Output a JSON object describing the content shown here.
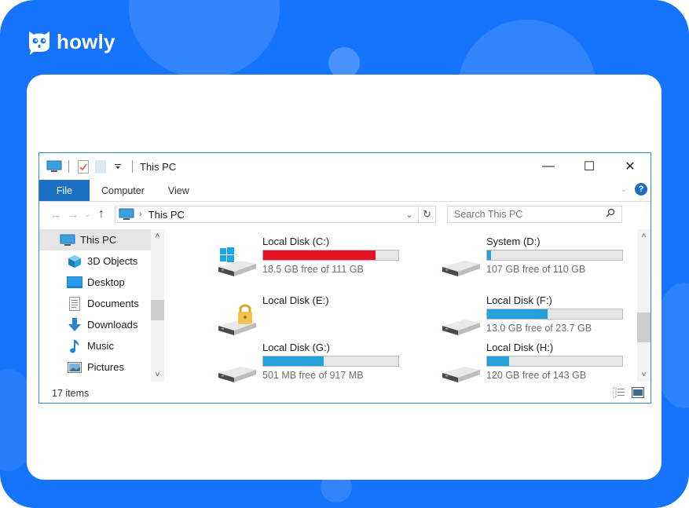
{
  "brand": {
    "name": "howly",
    "color": "#1574fb"
  },
  "window": {
    "title": "This PC",
    "quick_access_icons": [
      "computer-icon",
      "properties-icon",
      "new-folder-icon",
      "customize-dropdown-icon"
    ],
    "controls": {
      "minimize": "—",
      "maximize": "☐",
      "close": "✕"
    }
  },
  "ribbon": {
    "tabs": [
      {
        "label": "File",
        "active": true
      },
      {
        "label": "Computer",
        "active": false
      },
      {
        "label": "View",
        "active": false
      }
    ],
    "expand_icon": "⌄",
    "help_icon": "?"
  },
  "navigation": {
    "back": "←",
    "forward": "→",
    "recent": "⌄",
    "up": "↑",
    "address": {
      "separator": "›",
      "path": "This PC"
    },
    "address_dropdown": "⌄",
    "refresh": "↻",
    "search": {
      "placeholder": "Search This PC",
      "value": ""
    },
    "search_icon": "⚲"
  },
  "sidebar": {
    "items": [
      {
        "label": "This PC",
        "icon": "computer-icon",
        "selected": true
      },
      {
        "label": "3D Objects",
        "icon": "3d-objects-icon",
        "selected": false
      },
      {
        "label": "Desktop",
        "icon": "desktop-icon",
        "selected": false
      },
      {
        "label": "Documents",
        "icon": "documents-icon",
        "selected": false
      },
      {
        "label": "Downloads",
        "icon": "downloads-icon",
        "selected": false
      },
      {
        "label": "Music",
        "icon": "music-icon",
        "selected": false
      },
      {
        "label": "Pictures",
        "icon": "pictures-icon",
        "selected": false
      }
    ],
    "scroll_up": "˄",
    "scroll_down": "˅"
  },
  "drives": [
    {
      "name": "Local Disk (C:)",
      "free_text": "18.5 GB free of 111 GB",
      "used_fraction": 0.83,
      "bar_color": "#e81123",
      "icon": "windows-drive-icon",
      "show_bar": true
    },
    {
      "name": "System (D:)",
      "free_text": "107 GB free of 110 GB",
      "used_fraction": 0.03,
      "bar_color": "#26a0da",
      "icon": "hard-drive-icon",
      "show_bar": true
    },
    {
      "name": "Local Disk (E:)",
      "free_text": "",
      "used_fraction": 0,
      "bar_color": "#26a0da",
      "icon": "locked-drive-icon",
      "show_bar": false
    },
    {
      "name": "Local Disk (F:)",
      "free_text": "13.0 GB free of 23.7 GB",
      "used_fraction": 0.45,
      "bar_color": "#26a0da",
      "icon": "hard-drive-icon",
      "show_bar": true
    },
    {
      "name": "Local Disk (G:)",
      "free_text": "501 MB free of 917 MB",
      "used_fraction": 0.45,
      "bar_color": "#26a0da",
      "icon": "hard-drive-icon",
      "show_bar": true
    },
    {
      "name": "Local Disk (H:)",
      "free_text": "120 GB free of 143 GB",
      "used_fraction": 0.16,
      "bar_color": "#26a0da",
      "icon": "hard-drive-icon",
      "show_bar": true
    }
  ],
  "content_scroll": {
    "up": "˄",
    "down": "˅"
  },
  "status": {
    "item_count": "17 items"
  }
}
